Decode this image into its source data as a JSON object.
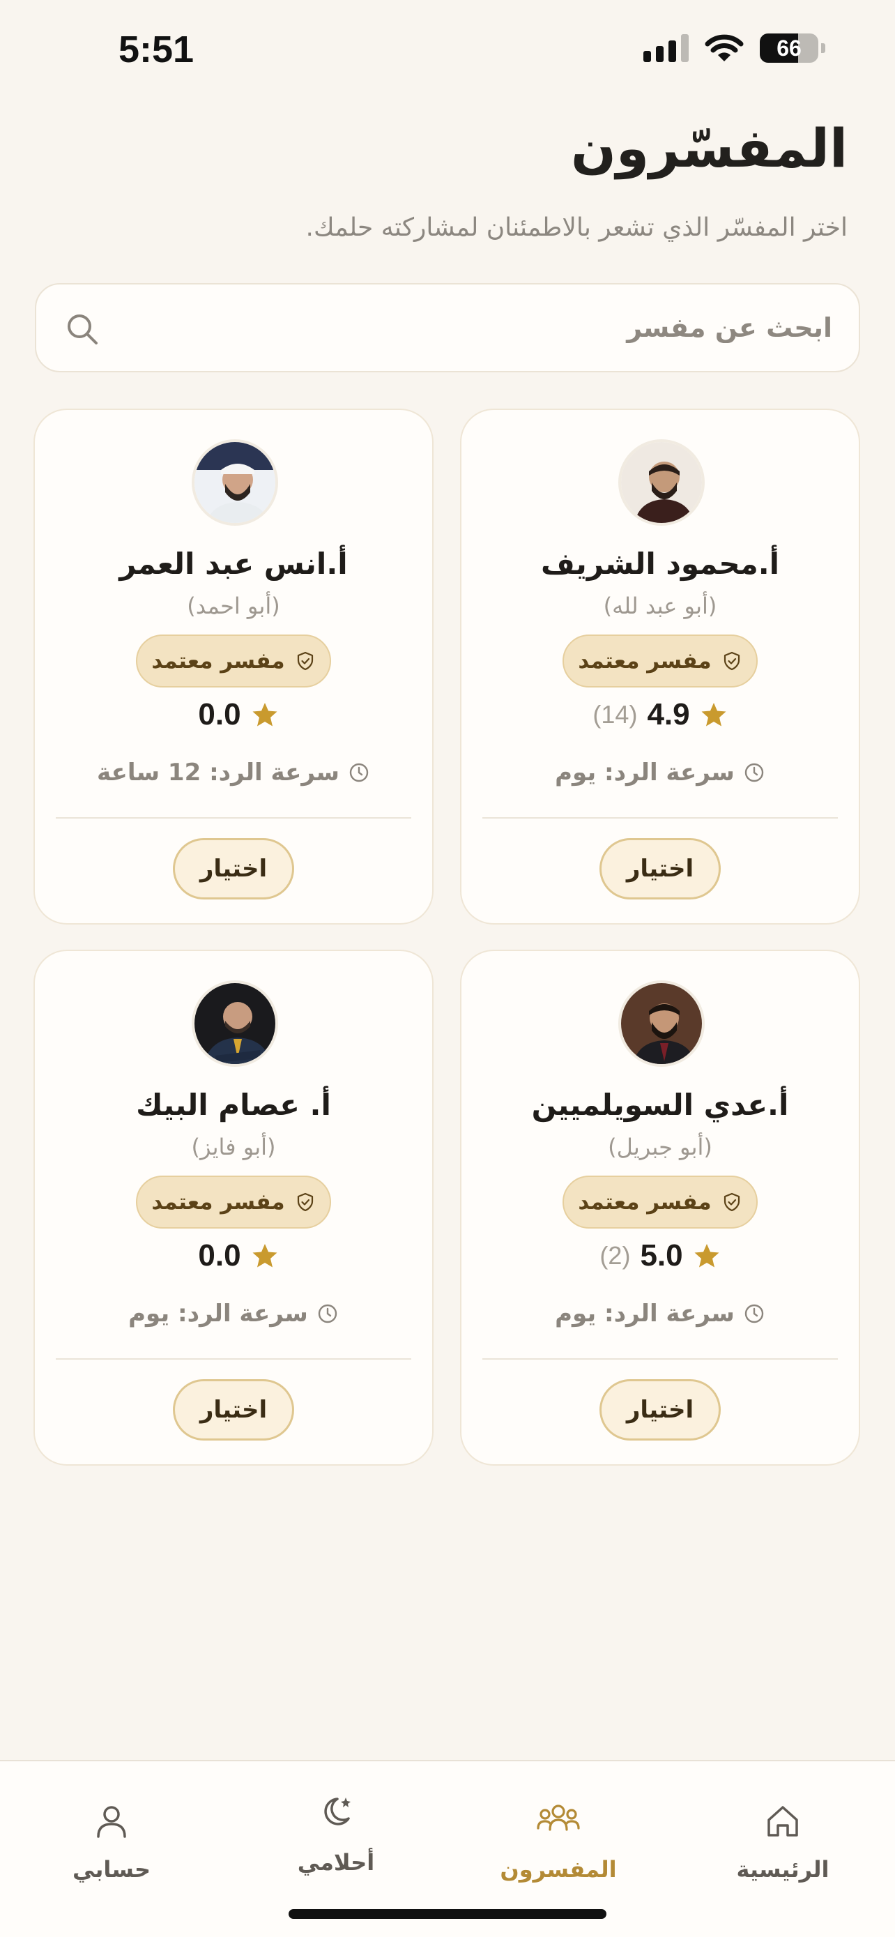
{
  "status_bar": {
    "time": "5:51",
    "battery": "66",
    "battery_level": 0.66
  },
  "header": {
    "title": "المفسّرون",
    "subtitle": "اختر المفسّر الذي تشعر بالاطمئنان لمشاركته حلمك."
  },
  "search": {
    "placeholder": "ابحث عن مفسر"
  },
  "cards": [
    {
      "name": "أ.محمود الشريف",
      "kunya": "(أبو عبد لله)",
      "badge": "مفسر معتمد",
      "rating": "4.9",
      "reviews": "(14)",
      "response": "سرعة الرد: يوم",
      "button": "اختيار"
    },
    {
      "name": "أ.انس عبد العمر",
      "kunya": "(أبو احمد)",
      "badge": "مفسر معتمد",
      "rating": "0.0",
      "reviews": "",
      "response": "سرعة الرد: 12 ساعة",
      "button": "اختيار"
    },
    {
      "name": "أ.عدي السويلميين",
      "kunya": "(أبو جبريل)",
      "badge": "مفسر معتمد",
      "rating": "5.0",
      "reviews": "(2)",
      "response": "سرعة الرد: يوم",
      "button": "اختيار"
    },
    {
      "name": "أ. عصام البيك",
      "kunya": "(أبو فايز)",
      "badge": "مفسر معتمد",
      "rating": "0.0",
      "reviews": "",
      "response": "سرعة الرد: يوم",
      "button": "اختيار"
    }
  ],
  "nav": [
    {
      "label": "الرئيسية",
      "icon": "home-icon"
    },
    {
      "label": "المفسرون",
      "icon": "people-icon",
      "active": true
    },
    {
      "label": "أحلامي",
      "icon": "moon-star-icon"
    },
    {
      "label": "حسابي",
      "icon": "user-icon"
    }
  ],
  "colors": {
    "accent": "#b38a35",
    "badge_bg": "#f3e3c2",
    "background": "#f9f5ef",
    "star": "#c99a2e"
  }
}
